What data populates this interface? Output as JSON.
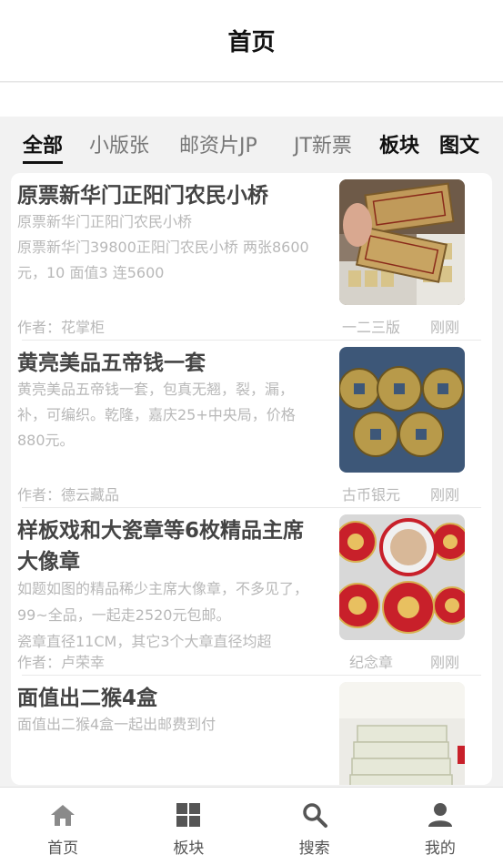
{
  "header": {
    "title": "首页"
  },
  "tabs": [
    {
      "label": "全部"
    },
    {
      "label": "小版张"
    },
    {
      "label": "邮资片JP"
    },
    {
      "label": "JT新票"
    },
    {
      "label": "板块"
    },
    {
      "label": "图文"
    }
  ],
  "cards": [
    {
      "title": "原票新华门正阳门农民小桥",
      "desc": "原票新华门正阳门农民小桥\n原票新华门39800正阳门农民小桥 两张8600 元，10 面值3 连5600",
      "author": "作者：花掌柜",
      "category": "一二三版",
      "time": "刚刚"
    },
    {
      "title": "黄亮美品五帝钱一套",
      "desc": "黄亮美品五帝钱一套，包真无翘，裂，漏，补，可编织。乾隆，嘉庆25+中央局，价格880元。",
      "author": "作者：德云藏品",
      "category": "古币银元",
      "time": "刚刚"
    },
    {
      "title": "样板戏和大瓷章等6枚精品主席大像章",
      "desc": "如题如图的精品稀少主席大像章，不多见了，99~全品，一起走2520元包邮。\n瓷章直径11CM，其它3个大章直径均超",
      "author": "作者：卢荣幸",
      "category": "纪念章",
      "time": "刚刚"
    },
    {
      "title": "面值出二猴4盒",
      "desc": "面值出二猴4盒一起出邮费到付",
      "author": "",
      "category": "",
      "time": ""
    }
  ],
  "bottom_nav": [
    {
      "label": "首页",
      "icon": "home-icon"
    },
    {
      "label": "板块",
      "icon": "grid-icon"
    },
    {
      "label": "搜索",
      "icon": "search-icon"
    },
    {
      "label": "我的",
      "icon": "person-icon"
    }
  ],
  "colors": {
    "accent": "#111111",
    "muted": "#b8b8b8",
    "title": "#444444"
  }
}
